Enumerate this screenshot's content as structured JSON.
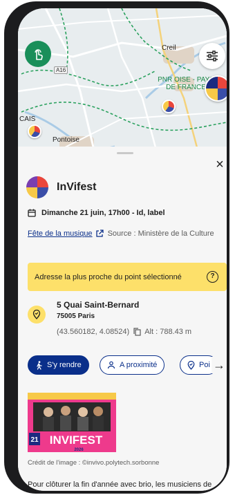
{
  "map": {
    "labels": {
      "creil": "Creil",
      "park_line1": "PNR OISE - PAYS",
      "park_line2": "DE FRANCE",
      "cais": "CAIS",
      "pontoise": "Pontoise",
      "road": "A16"
    }
  },
  "sheet": {
    "close_label": "×",
    "event": {
      "title": "InVifest",
      "date": "Dimanche 21 juin, 17h00 - Id, label",
      "source_link": "Fête de la musique",
      "source_text": "Source : Ministère de la Culture"
    },
    "banner": {
      "text": "Adresse la plus proche du point sélectionné",
      "help": "?"
    },
    "address": {
      "street": "5 Quai Saint-Bernard",
      "city": "75005 Paris",
      "coords": "(43.560182, 4.08524)",
      "altitude": "Alt : 788.43 m"
    },
    "actions": {
      "go": "S'y rendre",
      "nearby": "A proximité",
      "point": "Poi",
      "more_arrow": "→"
    },
    "image": {
      "poster_text": "INVIFEST",
      "poster_year": "2026",
      "poster_day": "21"
    },
    "credit": "Crédit de l'image : ©invivo.polytech.sorbonne",
    "description": "Pour clôturer la fin d'année avec brio, les musiciens de"
  },
  "colors": {
    "brand_blue": "#0a2f8a",
    "banner_yellow": "#fde06a",
    "gesture_green": "#1a8f5a"
  }
}
